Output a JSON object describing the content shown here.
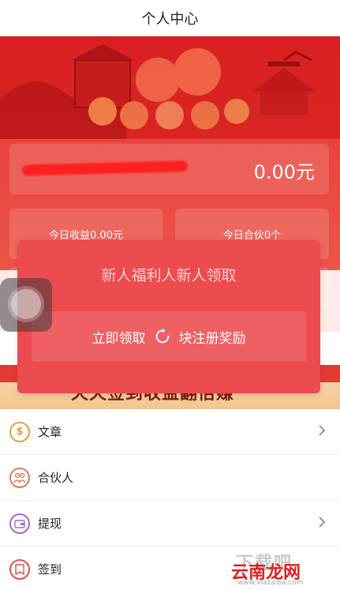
{
  "header": {
    "title": "个人中心"
  },
  "balance": {
    "amount": "0.00元"
  },
  "stats": {
    "today_income": "今日收益0.00元",
    "today_partner": "今日合伙0个"
  },
  "promo": {
    "text": "天天签到收益翻倍赚"
  },
  "dialog": {
    "title": "新人福利人新人领取",
    "button_left": "立即领取",
    "button_right": "块注册奖励"
  },
  "menu": {
    "items": [
      {
        "label": "文章",
        "icon": "dollar-icon",
        "color": "#e0a23a"
      },
      {
        "label": "合伙人",
        "icon": "partners-icon",
        "color": "#e07a5a"
      },
      {
        "label": "提现",
        "icon": "wallet-icon",
        "color": "#a46ad0"
      },
      {
        "label": "签到",
        "icon": "checkin-icon",
        "color": "#e05050"
      }
    ]
  },
  "watermark": {
    "top": "下载吧",
    "main": "云南龙网",
    "url": "www.xiazaiba.com"
  },
  "colors": {
    "banner_red": "#e8443d",
    "dialog_red": "#ec4b4f"
  }
}
